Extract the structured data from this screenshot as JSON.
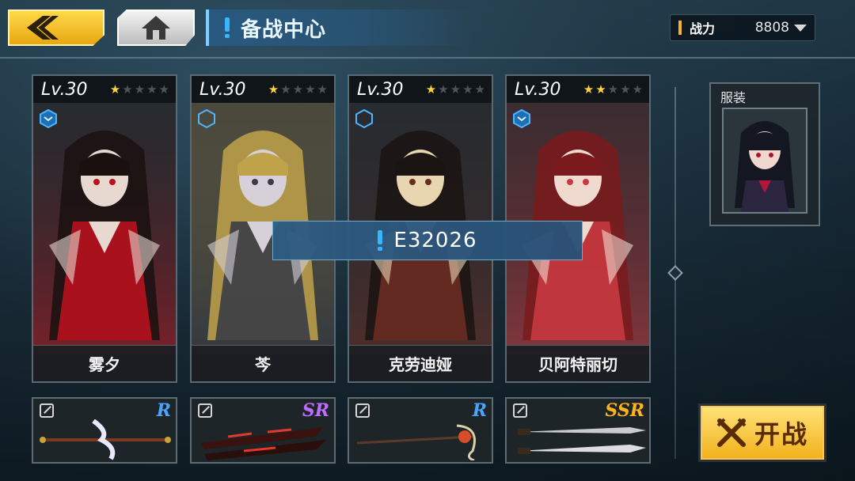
{
  "header": {
    "back_icon": "chevron-left-icon",
    "home_icon": "home-icon",
    "title": "备战中心",
    "power_label": "战力",
    "power_value": "8808"
  },
  "characters": [
    {
      "level": "Lv.30",
      "stars": 1,
      "max_stars": 5,
      "name": "雾夕",
      "hex_active": true,
      "palette": [
        "#b8121d",
        "#e7d8d0",
        "#1a1010"
      ]
    },
    {
      "level": "Lv.30",
      "stars": 1,
      "max_stars": 5,
      "name": "芩",
      "hex_active": false,
      "palette": [
        "#3a3d45",
        "#d6d0d8",
        "#c0a24a"
      ]
    },
    {
      "level": "Lv.30",
      "stars": 1,
      "max_stars": 5,
      "name": "克劳迪娅",
      "hex_active": false,
      "palette": [
        "#6a2c22",
        "#e7d6b0",
        "#1a1412"
      ]
    },
    {
      "level": "Lv.30",
      "stars": 2,
      "max_stars": 5,
      "name": "贝阿特丽切",
      "hex_active": true,
      "palette": [
        "#c73a3f",
        "#f0dad0",
        "#7a1a1c"
      ]
    }
  ],
  "weapons": [
    {
      "rarity": "R",
      "rarity_color": "#4aa3ff"
    },
    {
      "rarity": "SR",
      "rarity_color": "#c06cff"
    },
    {
      "rarity": "R",
      "rarity_color": "#4aa3ff"
    },
    {
      "rarity": "SSR",
      "rarity_color": "#ffb21f"
    }
  ],
  "popup": {
    "text": "E32026"
  },
  "outfit": {
    "label": "服装"
  },
  "start": {
    "label": "开战",
    "icon": "crossed-swords-icon"
  },
  "colors": {
    "accent": "#38b5ff",
    "gold": "#f2b01a",
    "star": "#ffd23a"
  }
}
